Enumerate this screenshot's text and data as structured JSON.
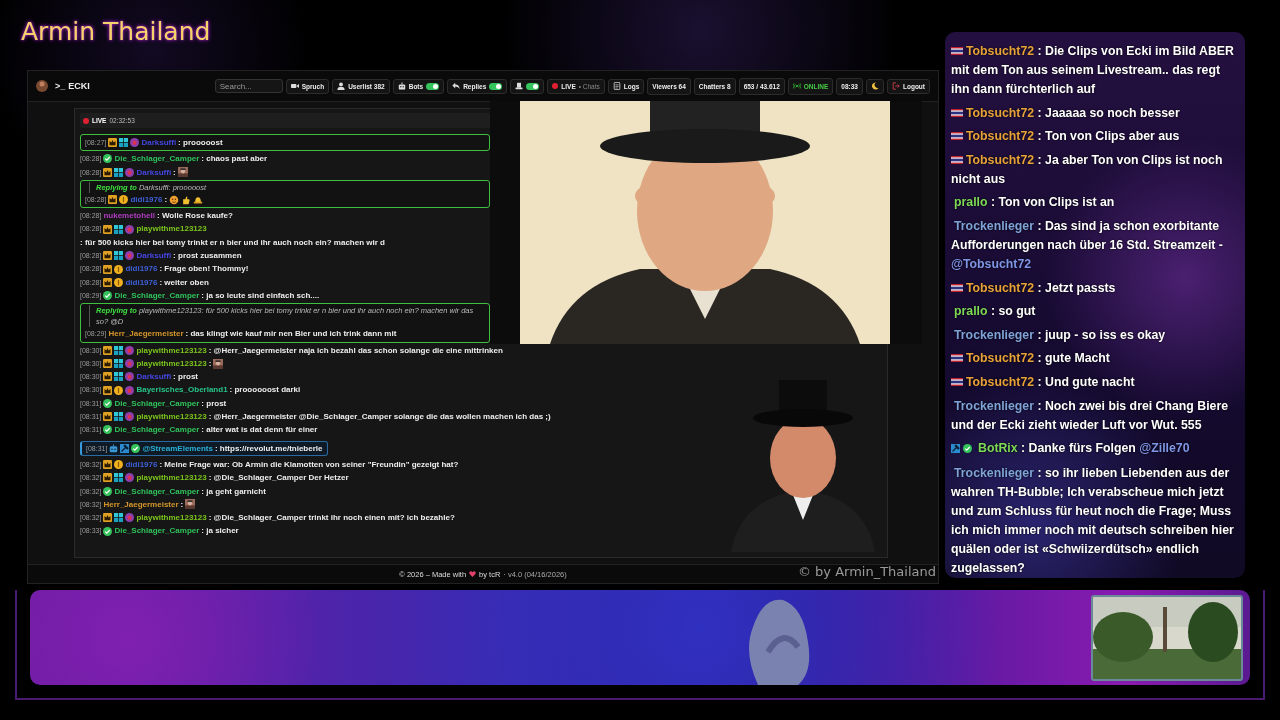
{
  "title": "Armin Thailand",
  "app": {
    "topbar": {
      "prompt": ">_",
      "brand": "ECKI",
      "search": {
        "placeholder": "Search..."
      },
      "items": [
        {
          "kind": "spruch",
          "label": "Spruch"
        },
        {
          "kind": "userlist",
          "label": "Userlist",
          "count": "382"
        },
        {
          "kind": "bots",
          "label": "Bots",
          "on": true
        },
        {
          "kind": "replies",
          "label": "Replies",
          "on": true
        },
        {
          "kind": "hat",
          "on": true
        },
        {
          "kind": "live",
          "label": "LIVE",
          "sub": "• Chats"
        },
        {
          "kind": "logs",
          "label": "Logs"
        },
        {
          "kind": "stat",
          "label": "Viewers",
          "count": "64"
        },
        {
          "kind": "stat",
          "label": "Chatters",
          "count": "8"
        },
        {
          "kind": "stat",
          "label": "653 / 43.612"
        },
        {
          "kind": "online",
          "label": "ONLINE"
        },
        {
          "kind": "stat",
          "label": "08:33"
        },
        {
          "kind": "theme"
        },
        {
          "kind": "logout",
          "label": "Logout"
        }
      ]
    },
    "live_bar": {
      "label": "LIVE",
      "time": "02:32:53"
    },
    "chat": {
      "messages": [
        {
          "kind": "reply",
          "time": "[08:27]",
          "badges": [
            {
              "kind": "crown"
            },
            {
              "kind": "grid"
            },
            {
              "kind": "emblem"
            }
          ],
          "user": "Darksuffi",
          "color": "#4446e0",
          "text": ": prooooost"
        },
        {
          "kind": "message",
          "time": "[08:28]",
          "badges": [
            {
              "kind": "verified"
            }
          ],
          "user": "Die_Schlager_Camper",
          "color": "#2fc25b",
          "text": ": chaos past aber"
        },
        {
          "kind": "message",
          "time": "[08:28]",
          "badges": [
            {
              "kind": "crown"
            },
            {
              "kind": "grid"
            },
            {
              "kind": "emblem"
            }
          ],
          "user": "Darksuffi",
          "color": "#4446e0",
          "text": ":"
        },
        {
          "kind": "reply",
          "replying_to": "Replying to",
          "reply_text": "Darksuffi: prooooost",
          "time": "[08:28]",
          "badges": [
            {
              "kind": "crown"
            },
            {
              "kind": "coin"
            }
          ],
          "user": "didi1976",
          "color": "#3e5fd8",
          "text": ":",
          "emotes": [
            {
              "kind": "face"
            },
            {
              "kind": "thumb"
            },
            {
              "kind": "hat"
            }
          ]
        },
        {
          "kind": "message",
          "time": "[08:28]",
          "user": "nukemetohell",
          "color": "#b03cc0",
          "text": ": Wolle Rose kaufe?"
        },
        {
          "kind": "message",
          "time": "[08:28]",
          "badges": [
            {
              "kind": "crown"
            },
            {
              "kind": "grid"
            },
            {
              "kind": "emblem"
            }
          ],
          "user": "playwithme123123",
          "color": "#7bc41c",
          "text": ": für 500 kicks hier bei tomy trinkt er n bier und ihr auch noch ein? machen wir d"
        },
        {
          "kind": "message",
          "time": "[08:28]",
          "badges": [
            {
              "kind": "crown"
            },
            {
              "kind": "grid"
            },
            {
              "kind": "emblem"
            }
          ],
          "user": "Darksuffi",
          "color": "#4446e0",
          "text": ": prost zusammen"
        },
        {
          "kind": "message",
          "time": "[08:28]",
          "badges": [
            {
              "kind": "crown"
            },
            {
              "kind": "coin"
            }
          ],
          "user": "didi1976",
          "color": "#3e5fd8",
          "text": ": Frage oben! Thommy!"
        },
        {
          "kind": "message",
          "time": "[08:28]",
          "badges": [
            {
              "kind": "crown"
            },
            {
              "kind": "coin"
            }
          ],
          "user": "didi1976",
          "color": "#3e5fd8",
          "text": ": weiter oben"
        },
        {
          "kind": "message",
          "time": "[08:29]",
          "badges": [
            {
              "kind": "verified"
            }
          ],
          "user": "Die_Schlager_Camper",
          "color": "#2fc25b",
          "text": ": ja so leute sind einfach sch...."
        },
        {
          "kind": "reply",
          "replying_to": "Replying to",
          "reply_text": "playwithme123123: für 500 kicks hier bei tomy trinkt er n bier und ihr auch noch ein? machen wir das so? @D",
          "time": "[08:29]",
          "user": "Herr_Jaegermeister",
          "color": "#d4952a",
          "text": ": das klingt wie kauf mir nen Bier und ich trink dann mit"
        }
      ],
      "messages_below_video": [
        {
          "kind": "message",
          "time": "[08:30]",
          "badges": [
            {
              "kind": "crown"
            },
            {
              "kind": "grid"
            },
            {
              "kind": "emblem"
            }
          ],
          "user": "playwithme123123",
          "color": "#7bc41c",
          "text": ": @Herr_Jaegermeister naja ich bezahl das schon solange die eine mittrinken"
        },
        {
          "kind": "message",
          "time": "[08:30]",
          "badges": [
            {
              "kind": "crown"
            },
            {
              "kind": "grid"
            },
            {
              "kind": "emblem"
            }
          ],
          "user": "playwithme123123",
          "color": "#7bc41c",
          "text": ":"
        },
        {
          "kind": "message",
          "time": "[08:30]",
          "badges": [
            {
              "kind": "crown"
            },
            {
              "kind": "grid"
            },
            {
              "kind": "emblem"
            }
          ],
          "user": "Darksuffi",
          "color": "#4446e0",
          "text": ": prost"
        },
        {
          "kind": "message",
          "time": "[08:30]",
          "badges": [
            {
              "kind": "crown"
            },
            {
              "kind": "coin"
            },
            {
              "kind": "emblem"
            }
          ],
          "user": "Bayerisches_Oberland1",
          "color": "#27c48a",
          "text": ": proooooost darki"
        },
        {
          "kind": "message",
          "time": "[08:31]",
          "badges": [
            {
              "kind": "verified"
            }
          ],
          "user": "Die_Schlager_Camper",
          "color": "#2fc25b",
          "text": ": prost"
        },
        {
          "kind": "message",
          "time": "[08:31]",
          "badges": [
            {
              "kind": "crown"
            },
            {
              "kind": "grid"
            },
            {
              "kind": "emblem"
            }
          ],
          "user": "playwithme123123",
          "color": "#7bc41c",
          "text": ": @Herr_Jaegermeister @Die_Schlager_Camper solange die das wollen machen ich das ;)"
        },
        {
          "kind": "message",
          "time": "[08:31]",
          "badges": [
            {
              "kind": "verified"
            }
          ],
          "user": "Die_Schlager_Camper",
          "color": "#2fc25b",
          "text": ": alter wat is dat denn für einer"
        },
        {
          "kind": "highlight",
          "time": "[08:31]",
          "badges": [
            {
              "kind": "robot"
            },
            {
              "kind": "hammer"
            },
            {
              "kind": "verified"
            }
          ],
          "user": "@StreamElements",
          "color": "#2ab0d8",
          "text": ": https://revolut.me/tnieberle"
        },
        {
          "kind": "message",
          "time": "[08:32]",
          "badges": [
            {
              "kind": "crown"
            },
            {
              "kind": "coin"
            }
          ],
          "user": "didi1976",
          "color": "#3e5fd8",
          "text": ": Meine Frage war: Ob Armin die Klamotten von seiner \"Freundin\" gezeigt hat?"
        },
        {
          "kind": "message",
          "time": "[08:32]",
          "badges": [
            {
              "kind": "crown"
            },
            {
              "kind": "grid"
            },
            {
              "kind": "emblem"
            }
          ],
          "user": "playwithme123123",
          "color": "#7bc41c",
          "text": ": @Die_Schlager_Camper Der Hetzer"
        },
        {
          "kind": "message",
          "time": "[08:32]",
          "badges": [
            {
              "kind": "verified"
            }
          ],
          "user": "Die_Schlager_Camper",
          "color": "#2fc25b",
          "text": ": ja geht garnicht"
        },
        {
          "kind": "message",
          "time": "[08:32]",
          "user": "Herr_Jaegermeister",
          "color": "#d4952a",
          "text": ":"
        },
        {
          "kind": "message",
          "time": "[08:32]",
          "badges": [
            {
              "kind": "crown"
            },
            {
              "kind": "grid"
            },
            {
              "kind": "emblem"
            }
          ],
          "user": "playwithme123123",
          "color": "#7bc41c",
          "text": ": @Die_Schlager_Camper trinkt ihr noch einen mit? ich bezahle?"
        },
        {
          "kind": "message",
          "time": "[08:33]",
          "badges": [
            {
              "kind": "verified"
            }
          ],
          "user": "Die_Schlager_Camper",
          "color": "#2fc25b",
          "text": ": ja sicher"
        }
      ]
    },
    "footer": {
      "made_with": "© 2026 – Made with",
      "by": "by tcR",
      "version": "· v4.0 (04/16/2026)"
    },
    "credit": "© by Armin_Thailand"
  },
  "side_chat": {
    "messages": [
      {
        "flag": true,
        "user": "Tobsucht72",
        "color": "#e8a23a",
        "text": " : Die Clips von Ecki im Bild ABER mit dem Ton aus seinem Livestream.. das regt ihn dann fürchterlich auf"
      },
      {
        "flag": true,
        "user": "Tobsucht72",
        "color": "#e8a23a",
        "text": " : Jaaaaa so noch besser"
      },
      {
        "flag": true,
        "user": "Tobsucht72",
        "color": "#e8a23a",
        "text": " : Ton von Clips aber aus"
      },
      {
        "flag": true,
        "user": "Tobsucht72",
        "color": "#e8a23a",
        "text": " : Ja aber Ton von Clips ist noch nicht aus"
      },
      {
        "flag": false,
        "user": "prallo",
        "color": "#7ed957",
        "text": " : Ton von Clips ist an"
      },
      {
        "flag": false,
        "user": "Trockenlieger",
        "color": "#7fa3d8",
        "text": " : Das sind ja schon exorbitante Aufforderungen nach über 16 Std. Streamzeit - ",
        "mention": "@Tobsucht72"
      },
      {
        "flag": true,
        "user": "Tobsucht72",
        "color": "#e8a23a",
        "text": " : Jetzt passts"
      },
      {
        "flag": false,
        "user": "prallo",
        "color": "#7ed957",
        "text": " : so gut"
      },
      {
        "flag": false,
        "user": "Trockenlieger",
        "color": "#7fa3d8",
        "text": " : juup - so iss es okay"
      },
      {
        "flag": true,
        "user": "Tobsucht72",
        "color": "#e8a23a",
        "text": " : gute Macht"
      },
      {
        "flag": true,
        "user": "Tobsucht72",
        "color": "#e8a23a",
        "text": " : Und gute nacht"
      },
      {
        "flag": false,
        "user": "Trockenlieger",
        "color": "#7fa3d8",
        "text": " : Noch zwei bis drei Chang Biere und der Ecki zieht wieder Luft vor Wut. 555"
      },
      {
        "flag": false,
        "badges": [
          {
            "kind": "hammer"
          },
          {
            "kind": "verified"
          }
        ],
        "user": "BotRix",
        "color": "#7ed957",
        "text": " : Danke fürs Folgen ",
        "mention": "@Zille70"
      },
      {
        "flag": false,
        "user": "Trockenlieger",
        "color": "#7fa3d8",
        "text": " : so ihr lieben Liebenden aus der wahren TH-Bubble; Ich verabscheue mich jetzt und zum Schluss für heut noch die Frage; Muss ich mich immer noch mit deutsch schreiben hier quälen oder ist «Schwiizerdütsch» endlich zugelassen?"
      }
    ]
  }
}
